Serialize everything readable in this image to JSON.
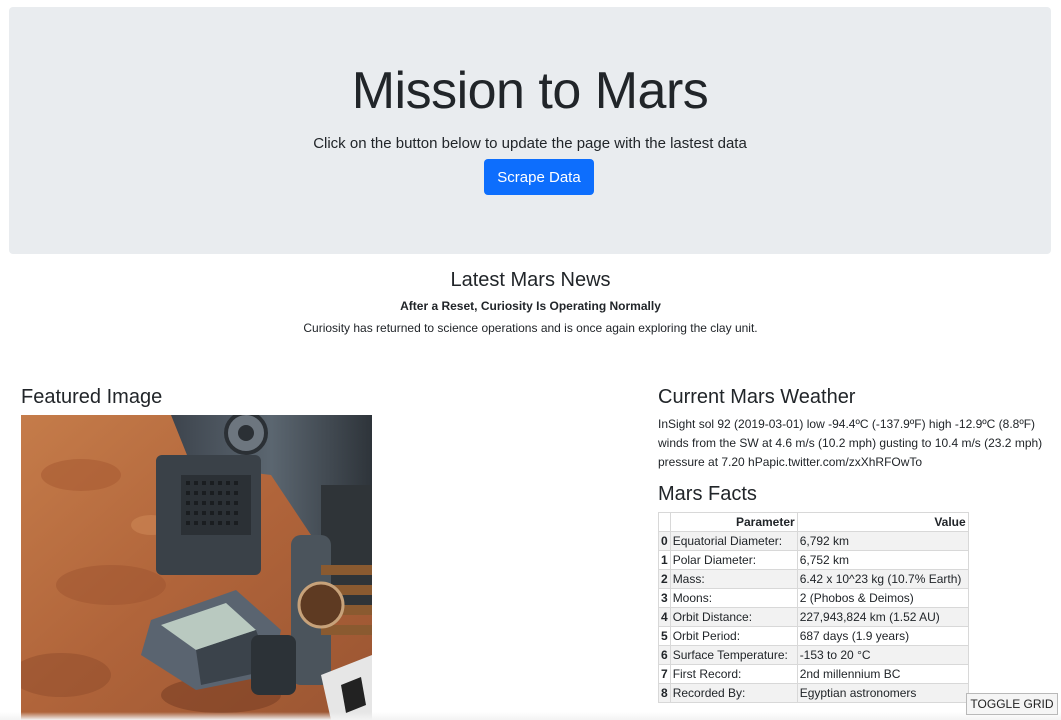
{
  "jumbotron": {
    "title": "Mission to Mars",
    "subtitle": "Click on the button below to update the page with the lastest data",
    "button_label": "Scrape Data",
    "button_color": "#0d6efd",
    "background_color": "#e9ecef"
  },
  "news": {
    "heading": "Latest Mars News",
    "title": "After a Reset, Curiosity Is Operating Normally",
    "teaser": "Curiosity has returned to science operations and is once again exploring the clay unit."
  },
  "featured": {
    "heading": "Featured Image",
    "image_icon": "mars-rover-scoop-image"
  },
  "weather": {
    "heading": "Current Mars Weather",
    "text": "InSight sol 92 (2019-03-01) low -94.4ºC (-137.9ºF) high -12.9ºC (8.8ºF) winds from the SW at 4.6 m/s (10.2 mph) gusting to 10.4 m/s (23.2 mph) pressure at 7.20 hPapic.twitter.com/zxXhRFOwTo"
  },
  "facts": {
    "heading": "Mars Facts",
    "columns": [
      "",
      "Parameter",
      "Value"
    ],
    "rows": [
      {
        "idx": "0",
        "param": "Equatorial Diameter:",
        "value": "6,792 km"
      },
      {
        "idx": "1",
        "param": "Polar Diameter:",
        "value": "6,752 km"
      },
      {
        "idx": "2",
        "param": "Mass:",
        "value": "6.42 x 10^23 kg (10.7% Earth)"
      },
      {
        "idx": "3",
        "param": "Moons:",
        "value": "2 (Phobos & Deimos)"
      },
      {
        "idx": "4",
        "param": "Orbit Distance:",
        "value": "227,943,824 km (1.52 AU)"
      },
      {
        "idx": "5",
        "param": "Orbit Period:",
        "value": "687 days (1.9 years)"
      },
      {
        "idx": "6",
        "param": "Surface Temperature:",
        "value": "-153 to 20 °C"
      },
      {
        "idx": "7",
        "param": "First Record:",
        "value": "2nd millennium BC"
      },
      {
        "idx": "8",
        "param": "Recorded By:",
        "value": "Egyptian astronomers"
      }
    ]
  },
  "toggle_grid_label": "TOGGLE GRID"
}
